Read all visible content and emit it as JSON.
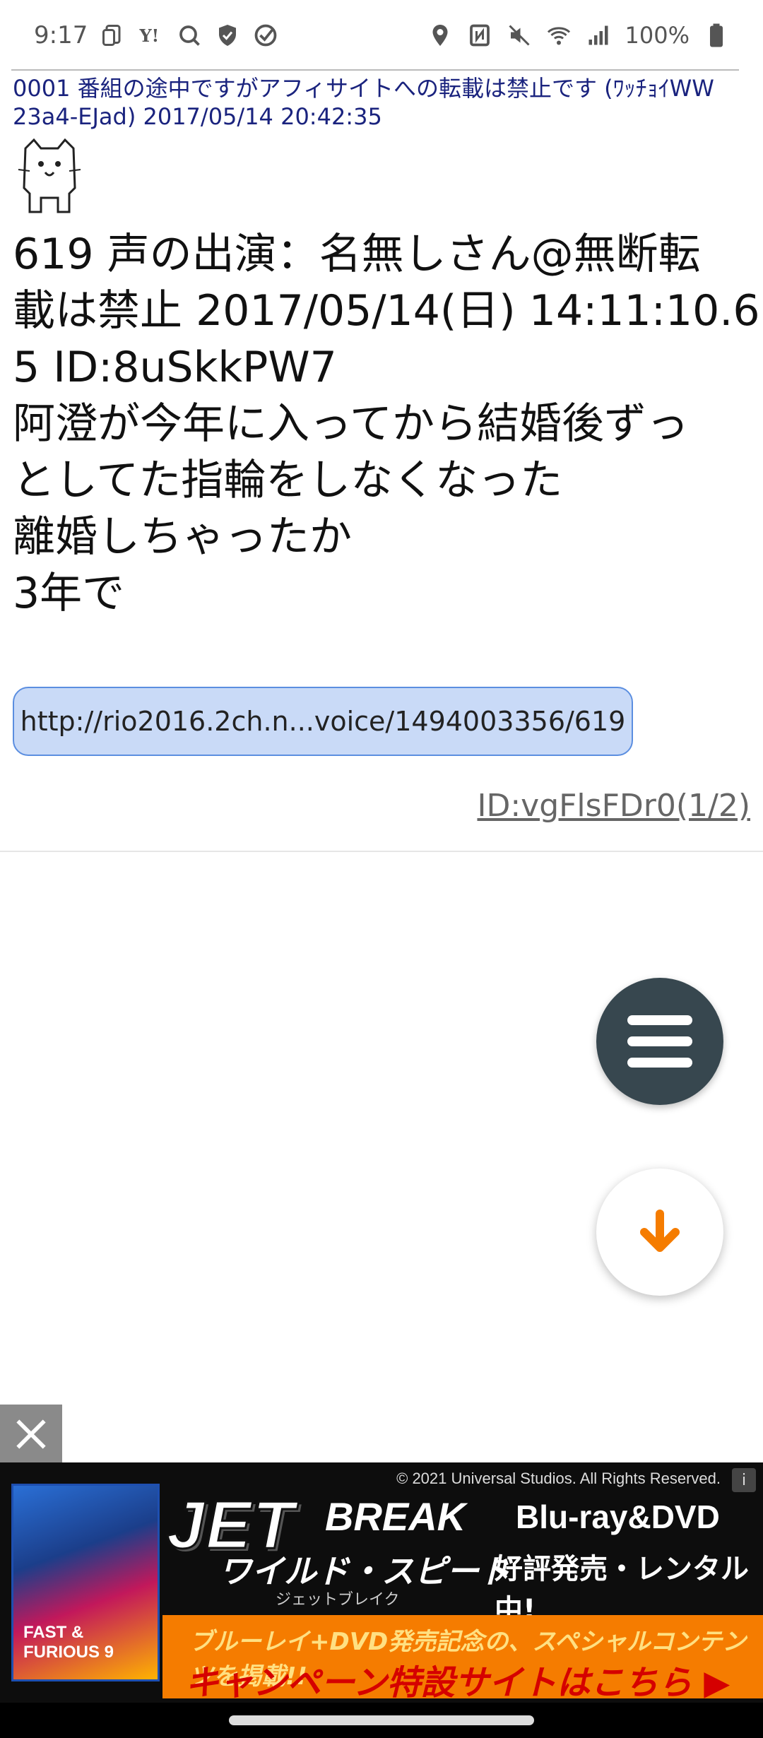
{
  "status_bar": {
    "time": "9:17",
    "battery": "100%",
    "left_icons": [
      "copy-icon",
      "yahoo-icon",
      "search-icon",
      "shield-icon",
      "check-circle-icon"
    ],
    "right_icons": [
      "location-icon",
      "nfc-icon",
      "mute-icon",
      "wifi-icon",
      "signal-icon",
      "battery-icon"
    ]
  },
  "post": {
    "header": "0001 番組の途中ですがアフィサイトへの転載は禁止です (ﾜｯﾁｮｲWW 23a4-EJad) 2017/05/14 20:42:35",
    "body_lines": [
      "619 声の出演：名無しさん@無断転",
      "載は禁止 2017/05/14(日) 14:11:10.6",
      "5 ID:8uSkkPW7",
      "阿澄が今年に入ってから結婚後ずっ",
      "としてた指輪をしなくなった",
      "離婚しちゃったか",
      "3年で"
    ],
    "link": "http://rio2016.2ch.n...voice/1494003356/619",
    "id_link": "ID:vgFlsFDr0(1/2)"
  },
  "fab": {
    "menu_icon": "hamburger-icon",
    "down_icon": "arrow-down-icon",
    "down_color": "#f57c00",
    "menu_color": "#37474f"
  },
  "ad": {
    "copyright": "© 2021 Universal Studios. All Rights Reserved.",
    "title_main": "JET",
    "title_break": "BREAK",
    "title_jp": "ワイルド・スピード",
    "title_kana": "ジェットブレイク",
    "cover_label": "FAST & FURIOUS 9",
    "format": "Blu-ray&DVD",
    "release": "好評発売・レンタル中!",
    "strip_line1": "ブルーレイ+DVD発売記念の、スペシャルコンテンツを掲載!!",
    "strip_line2": "キャンペーン特設サイトはこちら ▶",
    "info": "i"
  }
}
